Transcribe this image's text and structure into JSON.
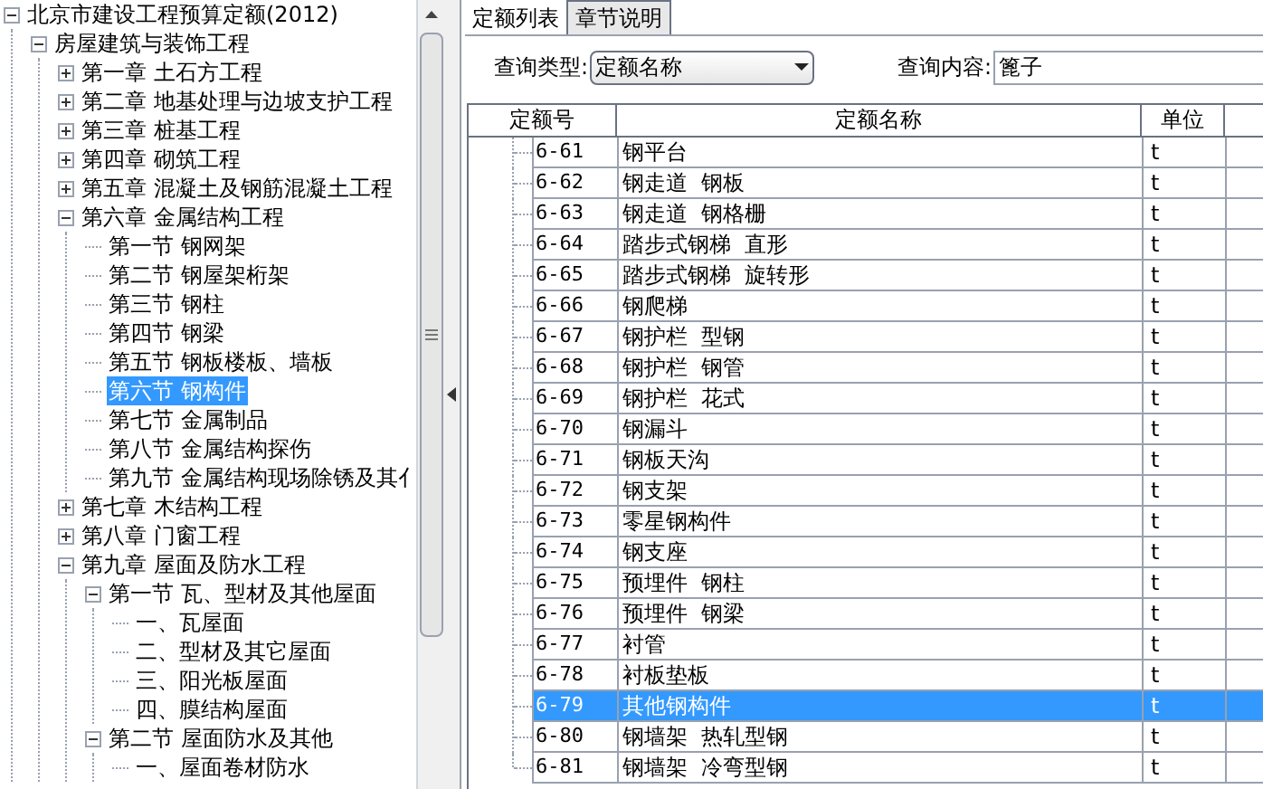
{
  "tree": [
    {
      "label": "北京市建设工程预算定额(2012)",
      "expanded": true,
      "selected": false,
      "children": [
        {
          "label": "房屋建筑与装饰工程",
          "expanded": true,
          "selected": false,
          "children": [
            {
              "label": "第一章  土石方工程",
              "expanded": false,
              "selected": false
            },
            {
              "label": "第二章  地基处理与边坡支护工程",
              "expanded": false,
              "selected": false
            },
            {
              "label": "第三章  桩基工程",
              "expanded": false,
              "selected": false
            },
            {
              "label": "第四章  砌筑工程",
              "expanded": false,
              "selected": false
            },
            {
              "label": "第五章  混凝土及钢筋混凝土工程",
              "expanded": false,
              "selected": false
            },
            {
              "label": "第六章  金属结构工程",
              "expanded": true,
              "selected": false,
              "children": [
                {
                  "label": "第一节  钢网架",
                  "selected": false
                },
                {
                  "label": "第二节  钢屋架桁架",
                  "selected": false
                },
                {
                  "label": "第三节  钢柱",
                  "selected": false
                },
                {
                  "label": "第四节  钢梁",
                  "selected": false
                },
                {
                  "label": "第五节  钢板楼板、墙板",
                  "selected": false
                },
                {
                  "label": "第六节  钢构件",
                  "selected": true
                },
                {
                  "label": "第七节  金属制品",
                  "selected": false
                },
                {
                  "label": "第八节  金属结构探伤",
                  "selected": false
                },
                {
                  "label": "第九节  金属结构现场除锈及其亻",
                  "selected": false
                }
              ]
            },
            {
              "label": "第七章  木结构工程",
              "expanded": false,
              "selected": false
            },
            {
              "label": "第八章  门窗工程",
              "expanded": false,
              "selected": false
            },
            {
              "label": "第九章  屋面及防水工程",
              "expanded": true,
              "selected": false,
              "children": [
                {
                  "label": "第一节  瓦、型材及其他屋面",
                  "expanded": true,
                  "selected": false,
                  "children": [
                    {
                      "label": "一、瓦屋面",
                      "selected": false
                    },
                    {
                      "label": "二、型材及其它屋面",
                      "selected": false
                    },
                    {
                      "label": "三、阳光板屋面",
                      "selected": false
                    },
                    {
                      "label": "四、膜结构屋面",
                      "selected": false
                    }
                  ]
                },
                {
                  "label": "第二节  屋面防水及其他",
                  "expanded": true,
                  "selected": false,
                  "children": [
                    {
                      "label": "一、屋面卷材防水",
                      "selected": false
                    }
                  ]
                }
              ]
            }
          ]
        }
      ]
    }
  ],
  "tabs": [
    {
      "label": "定额列表",
      "selected": true
    },
    {
      "label": "章节说明",
      "selected": false
    }
  ],
  "query_type": {
    "label": "查询类型:",
    "value": "定额名称"
  },
  "query_content": {
    "label": "查询内容:",
    "value": "篦子"
  },
  "table": {
    "columns": [
      "定额号",
      "定额名称",
      "单位"
    ],
    "rows": [
      {
        "code": "6-61",
        "name": "钢平台",
        "unit": "t",
        "selected": false
      },
      {
        "code": "6-62",
        "name": "钢走道  钢板",
        "unit": "t",
        "selected": false
      },
      {
        "code": "6-63",
        "name": "钢走道  钢格栅",
        "unit": "t",
        "selected": false
      },
      {
        "code": "6-64",
        "name": "踏步式钢梯  直形",
        "unit": "t",
        "selected": false
      },
      {
        "code": "6-65",
        "name": "踏步式钢梯  旋转形",
        "unit": "t",
        "selected": false
      },
      {
        "code": "6-66",
        "name": "钢爬梯",
        "unit": "t",
        "selected": false
      },
      {
        "code": "6-67",
        "name": "钢护栏  型钢",
        "unit": "t",
        "selected": false
      },
      {
        "code": "6-68",
        "name": "钢护栏  钢管",
        "unit": "t",
        "selected": false
      },
      {
        "code": "6-69",
        "name": "钢护栏  花式",
        "unit": "t",
        "selected": false
      },
      {
        "code": "6-70",
        "name": "钢漏斗",
        "unit": "t",
        "selected": false
      },
      {
        "code": "6-71",
        "name": "钢板天沟",
        "unit": "t",
        "selected": false
      },
      {
        "code": "6-72",
        "name": "钢支架",
        "unit": "t",
        "selected": false
      },
      {
        "code": "6-73",
        "name": "零星钢构件",
        "unit": "t",
        "selected": false
      },
      {
        "code": "6-74",
        "name": "钢支座",
        "unit": "t",
        "selected": false
      },
      {
        "code": "6-75",
        "name": "预埋件  钢柱",
        "unit": "t",
        "selected": false
      },
      {
        "code": "6-76",
        "name": "预埋件  钢梁",
        "unit": "t",
        "selected": false
      },
      {
        "code": "6-77",
        "name": "衬管",
        "unit": "t",
        "selected": false
      },
      {
        "code": "6-78",
        "name": "衬板垫板",
        "unit": "t",
        "selected": false
      },
      {
        "code": "6-79",
        "name": "其他钢构件",
        "unit": "t",
        "selected": true
      },
      {
        "code": "6-80",
        "name": "钢墙架  热轧型钢",
        "unit": "t",
        "selected": false
      },
      {
        "code": "6-81",
        "name": "钢墙架  冷弯型钢",
        "unit": "t",
        "selected": false
      }
    ]
  }
}
